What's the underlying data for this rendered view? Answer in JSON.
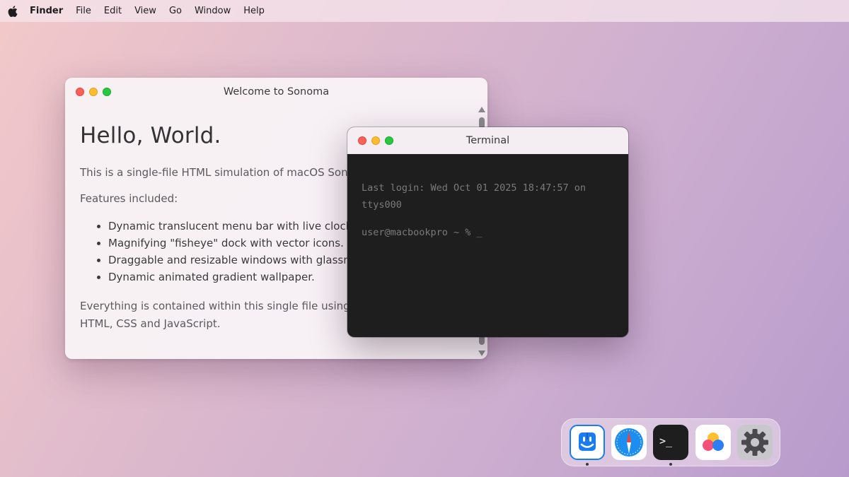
{
  "menubar": {
    "apple_icon": "apple-logo-icon",
    "items": [
      "Finder",
      "File",
      "Edit",
      "View",
      "Go",
      "Window",
      "Help"
    ]
  },
  "welcome_window": {
    "title": "Welcome to Sonoma",
    "heading": "Hello, World.",
    "intro": "This is a single-file HTML simulation of macOS Sonoma",
    "features_label": "Features included:",
    "features": [
      "Dynamic translucent menu bar with live clock.",
      "Magnifying \"fisheye\" dock with vector icons.",
      "Draggable and resizable windows with glassmorphism.",
      "Dynamic animated gradient wallpaper."
    ],
    "footer": "Everything is contained within this single file using HTML, CSS and JavaScript."
  },
  "terminal_window": {
    "title": "Terminal",
    "last_login": "Last login: Wed Oct 01 2025 18:47:57 on ttys000",
    "prompt": "user@macbookpro ~ % _"
  },
  "dock": {
    "items": [
      {
        "name": "finder-icon",
        "running": true
      },
      {
        "name": "safari-icon",
        "running": false
      },
      {
        "name": "terminal-icon",
        "glyph": ">_",
        "running": true
      },
      {
        "name": "photos-icon",
        "running": false
      },
      {
        "name": "settings-icon",
        "running": false
      }
    ]
  },
  "colors": {
    "close": "#fe5f57",
    "minimize": "#febc2e",
    "zoom": "#28c840",
    "terminal_bg": "#1e1e1e",
    "finder_blue": "#1a7cf2"
  }
}
